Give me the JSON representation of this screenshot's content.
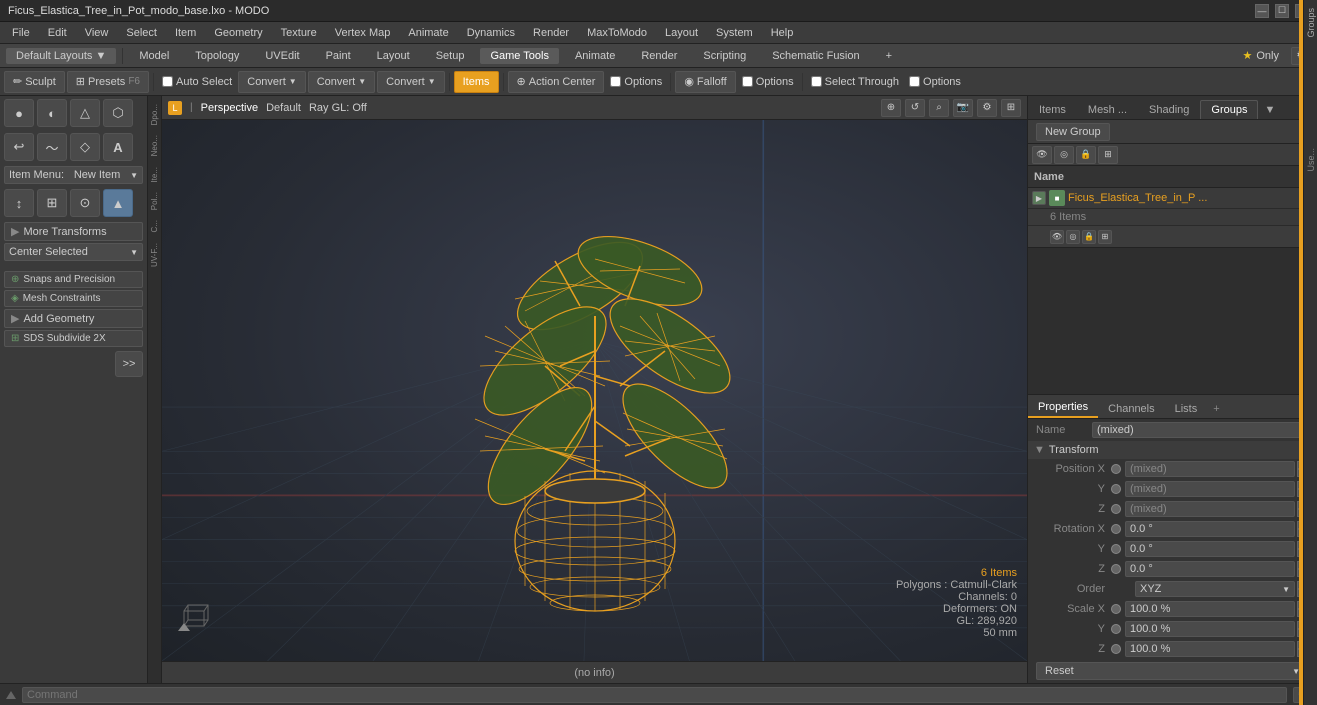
{
  "window": {
    "title": "Ficus_Elastica_Tree_in_Pot_modo_base.lxo - MODO"
  },
  "titlebar": {
    "minimize": "—",
    "maximize": "☐",
    "close": "✕"
  },
  "menubar": {
    "items": [
      "File",
      "Edit",
      "View",
      "Select",
      "Item",
      "Geometry",
      "Texture",
      "Vertex Map",
      "Animate",
      "Dynamics",
      "Render",
      "MaxToModo",
      "Layout",
      "System",
      "Help"
    ]
  },
  "layoutbar": {
    "left_btn": "Default Layouts",
    "tabs": [
      "Model",
      "Topology",
      "UVEdit",
      "Paint",
      "Layout",
      "Setup",
      "Game Tools",
      "Animate",
      "Render",
      "Scripting",
      "Schematic Fusion"
    ],
    "active": "Model",
    "plus": "+",
    "star_only": "★  Only"
  },
  "toolbar": {
    "sculpt": "Sculpt",
    "presets": "Presets",
    "f6": "F6",
    "auto_select": "Auto Select",
    "convert1": "Convert",
    "convert2": "Convert",
    "convert3": "Convert",
    "items": "Items",
    "action_center": "Action Center",
    "options1": "Options",
    "falloff": "Falloff",
    "options2": "Options",
    "select_through": "Select Through"
  },
  "viewport": {
    "perspective": "Perspective",
    "default": "Default",
    "ray_gl": "Ray GL: Off",
    "status_items": "6 Items",
    "polygons": "Polygons : Catmull-Clark",
    "channels": "Channels: 0",
    "deformers": "Deformers: ON",
    "gl_count": "GL: 289,920",
    "size": "50 mm",
    "info": "(no info)"
  },
  "left_tools": {
    "tool_rows": [
      [
        "●",
        "◐",
        "▲",
        "⬡"
      ],
      [
        "↩",
        "〜",
        "⬟",
        "A"
      ],
      [
        "item_menu_label",
        "New Item"
      ],
      [
        "↕",
        "⊞",
        "⬤",
        "▲"
      ],
      [
        "more_transforms",
        "More Transforms"
      ],
      [
        "center_selected",
        "Center Selected"
      ],
      [
        "snaps",
        "Snaps and Precision"
      ],
      [
        "mesh_constraints",
        "Mesh Constraints"
      ],
      [
        "add_geometry",
        "Add Geometry"
      ],
      [
        "sds",
        "SDS Subdivide 2X"
      ]
    ]
  },
  "right_panel": {
    "tabs": [
      "Items",
      "Mesh ...",
      "Shading",
      "Groups"
    ],
    "active_tab": "Groups",
    "new_group_btn": "New Group",
    "col_name": "Name",
    "item_name": "Ficus_Elastica_Tree_in_P ...",
    "item_count": "6 Items",
    "properties_tabs": [
      "Properties",
      "Channels",
      "Lists",
      "+"
    ],
    "active_prop_tab": "Properties",
    "name_label": "Name",
    "name_value": "(mixed)",
    "transform_label": "Transform",
    "position_x_label": "Position X",
    "position_y_label": "Y",
    "position_z_label": "Z",
    "position_x_val": "(mixed)",
    "position_y_val": "(mixed)",
    "position_z_val": "(mixed)",
    "rotation_x_label": "Rotation X",
    "rotation_y_label": "Y",
    "rotation_z_label": "Z",
    "rotation_x_val": "0.0 °",
    "rotation_y_val": "0.0 °",
    "rotation_z_val": "0.0 °",
    "order_label": "Order",
    "order_val": "XYZ",
    "scale_x_label": "Scale X",
    "scale_y_label": "Y",
    "scale_z_label": "Z",
    "scale_x_val": "100.0 %",
    "scale_y_val": "100.0 %",
    "scale_z_val": "100.0 %",
    "reset_btn": "Reset"
  },
  "cmdbar": {
    "placeholder": "Command",
    "icon": "⚙"
  },
  "icons": {
    "arrow_down": "▼",
    "arrow_up": "▲",
    "arrow_right": "▶",
    "arrow_left": "◀",
    "check": "✓",
    "plus": "+",
    "gear": "⚙",
    "eye": "👁",
    "lock": "🔒",
    "expand": "⊞",
    "list": "☰",
    "grid": "⊟"
  }
}
